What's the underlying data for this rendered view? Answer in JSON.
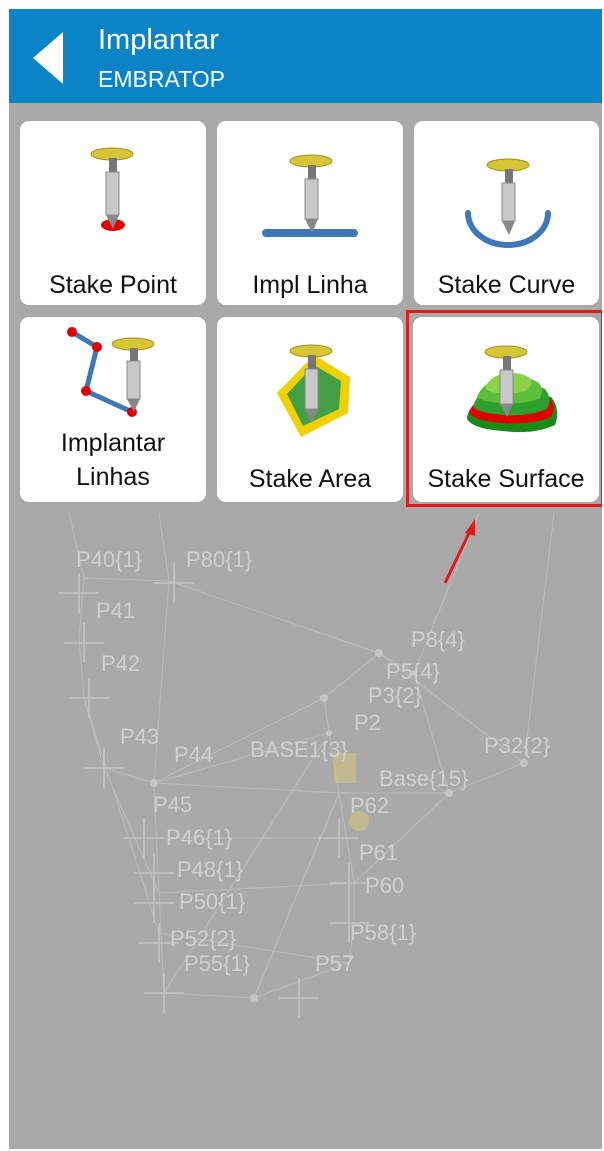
{
  "header": {
    "title": "Implantar",
    "subtitle": "EMBRATOP"
  },
  "tiles": [
    {
      "label": "Stake Point"
    },
    {
      "label": "Impl Linha"
    },
    {
      "label": "Stake Curve"
    },
    {
      "label_line1": "Implantar",
      "label_line2": "Linhas"
    },
    {
      "label": "Stake Area"
    },
    {
      "label": "Stake Surface"
    }
  ],
  "map_points": [
    "P40{1}",
    "P80{1}",
    "P41",
    "P42",
    "P8{4}",
    "P5{4}",
    "P3{2}",
    "P2",
    "P43",
    "P44",
    "BASE1{3}",
    "P32{2}",
    "Base{15}",
    "P45",
    "P62",
    "P46{1}",
    "P61",
    "P48{1}",
    "P60",
    "P50{1}",
    "P58{1}",
    "P52{2}",
    "P55{1}",
    "P57"
  ],
  "colors": {
    "header": "#0a84c6",
    "highlight": "#e01b1b",
    "background": "#a9a9a9"
  }
}
